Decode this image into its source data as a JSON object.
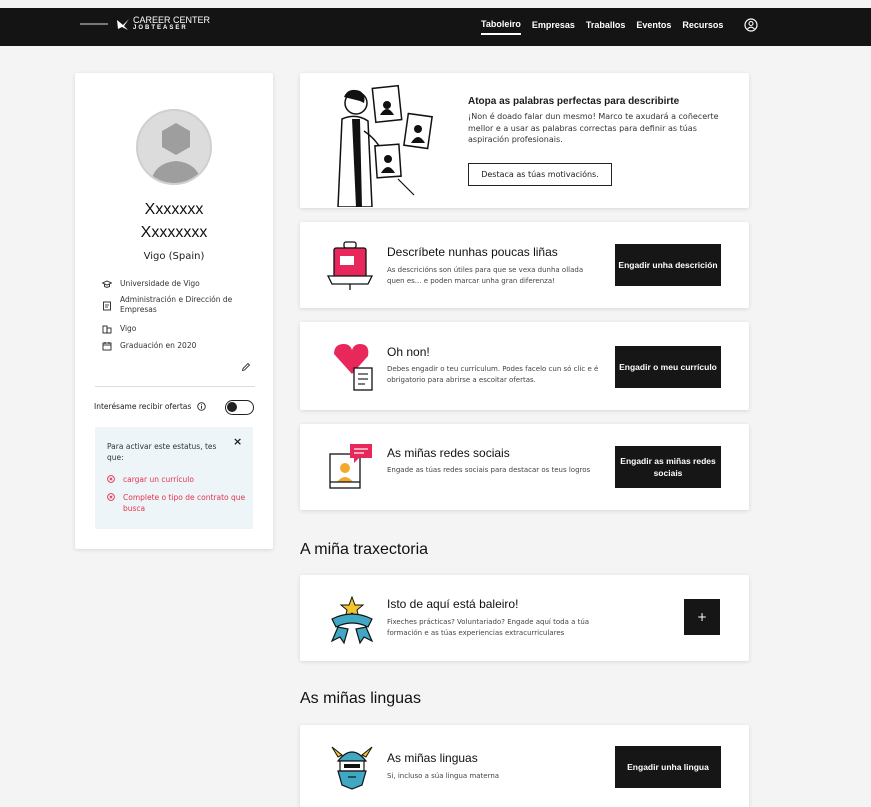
{
  "header": {
    "small_brand": "University logo",
    "brand_line1": "CAREER CENTER",
    "brand_line2": "JOBTEASER",
    "nav": [
      {
        "label": "Taboleiro",
        "active": true
      },
      {
        "label": "Empresas",
        "active": false
      },
      {
        "label": "Traballos",
        "active": false
      },
      {
        "label": "Eventos",
        "active": false
      },
      {
        "label": "Recursos",
        "active": false
      }
    ]
  },
  "profile": {
    "first_name": "Xxxxxxx",
    "last_name": "Xxxxxxxx",
    "location": "Vigo (Spain)",
    "university": "Universidade de Vigo",
    "degree": "Administración e Dirección de Empresas",
    "city": "Vigo",
    "graduation": "Graduación en 2020",
    "offers_label": "Interésame recibir ofertas",
    "notice_text": "Para activar este estatus, tes que:",
    "requirement_1": "cargar un currículo",
    "requirement_2": "Complete o tipo de contrato que busca"
  },
  "hero": {
    "title": "Atopa as palabras perfectas para describirte",
    "description": "¡Non é doado falar dun mesmo! Marco te axudará a coñecerte mellor e a usar as palabras correctas para definir as túas aspiración profesionais.",
    "button": "Destaca as túas motivacións."
  },
  "cards": {
    "describe": {
      "title": "Descríbete nunhas poucas liñas",
      "description": "As descricións son útiles para que se vexa dunha ollada quen es... e poden marcar unha gran diferenza!",
      "button": "Engadir unha descrición"
    },
    "cv": {
      "title": "Oh non!",
      "description": "Debes engadir o teu currículum. Podes facelo cun só clic e é obrigatorio para abrirse a escoitar ofertas.",
      "button": "Engadir o meu currículo"
    },
    "social": {
      "title": "As miñas redes sociais",
      "description": "Engade as túas redes sociais para destacar os teus logros",
      "button": "Engadir as miñas redes sociais"
    }
  },
  "trajectory": {
    "heading": "A miña traxectoria",
    "title": "Isto de aquí está baleiro!",
    "description": "Fixeches prácticas? Voluntariado? Engade aquí toda a túa formación e as túas experiencias extracurriculares",
    "button": "+"
  },
  "languages": {
    "heading": "As miñas linguas",
    "title": "As miñas linguas",
    "description": "Si, incluso a súa lingua materna",
    "button": "Engadir unha lingua"
  },
  "colors": {
    "topbar": "#141414",
    "accent_pink": "#e8275a",
    "error_red": "#e2344f",
    "notice_bg": "#eef5f8"
  }
}
